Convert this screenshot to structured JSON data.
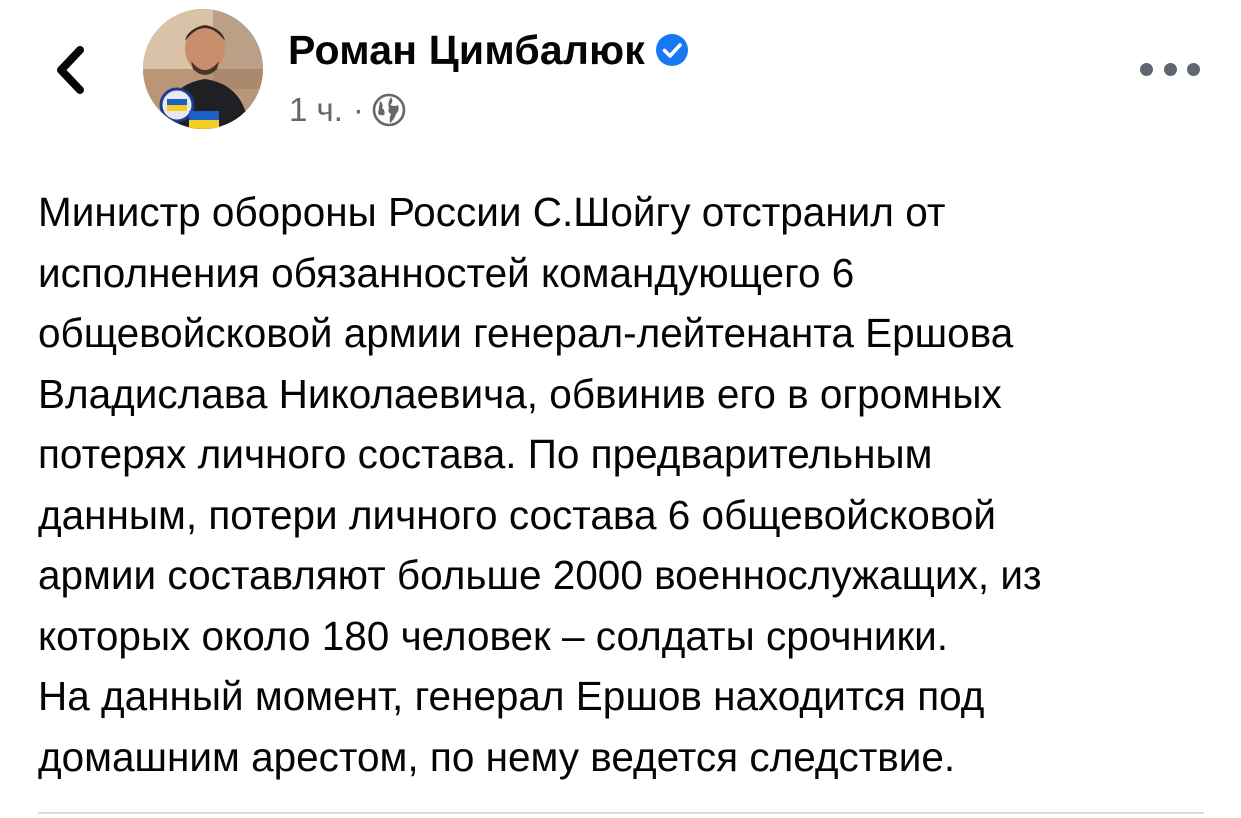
{
  "post": {
    "author": "Роман Цимбалюк",
    "time": "1 ч.",
    "separator": "·",
    "icons": {
      "back": "chevron-left-icon",
      "verified": "verified-badge-icon",
      "audience": "globe-icon",
      "more": "more-horizontal-icon"
    },
    "colors": {
      "verified": "#1877f2",
      "meta_text": "#65676b",
      "body_text": "#050505",
      "divider": "#dadde1"
    },
    "text_lines": [
      "Министр обороны России С.Шойгу отстранил от",
      "исполнения обязанностей командующего 6",
      "общевойсковой армии генерал-лейтенанта Ершова",
      "Владислава Николаевича, обвинив его в огромных",
      "потерях личного состава. По предварительным",
      "данным, потери личного состава 6 общевойсковой",
      "армии составляют больше 2000 военнослужащих, из",
      "которых около 180 человек – солдаты срочники.",
      "На данный момент, генерал Ершов находится под",
      "домашним арестом, по нему ведется следствие."
    ]
  }
}
